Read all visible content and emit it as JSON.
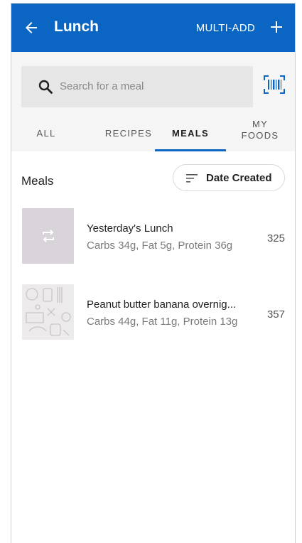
{
  "appbar": {
    "title": "Lunch",
    "multi_add": "MULTI-ADD",
    "accent": "#0a66c2"
  },
  "search": {
    "placeholder": "Search for a meal"
  },
  "tabs": [
    {
      "label": "ALL"
    },
    {
      "label": "RECIPES"
    },
    {
      "label": "MEALS",
      "active": true
    },
    {
      "label_line1": "MY",
      "label_line2": "FOODS"
    }
  ],
  "section": {
    "title": "Meals",
    "sort_label": "Date Created"
  },
  "meals": [
    {
      "name": "Yesterday's Lunch",
      "macros": "Carbs 34g, Fat 5g, Protein 36g",
      "calories": "325",
      "thumb_icon": "repeat-icon"
    },
    {
      "name": "Peanut butter banana overnig...",
      "macros": "Carbs 44g, Fat 11g, Protein 13g",
      "calories": "357",
      "thumb_icon": "food-pattern-image"
    }
  ]
}
